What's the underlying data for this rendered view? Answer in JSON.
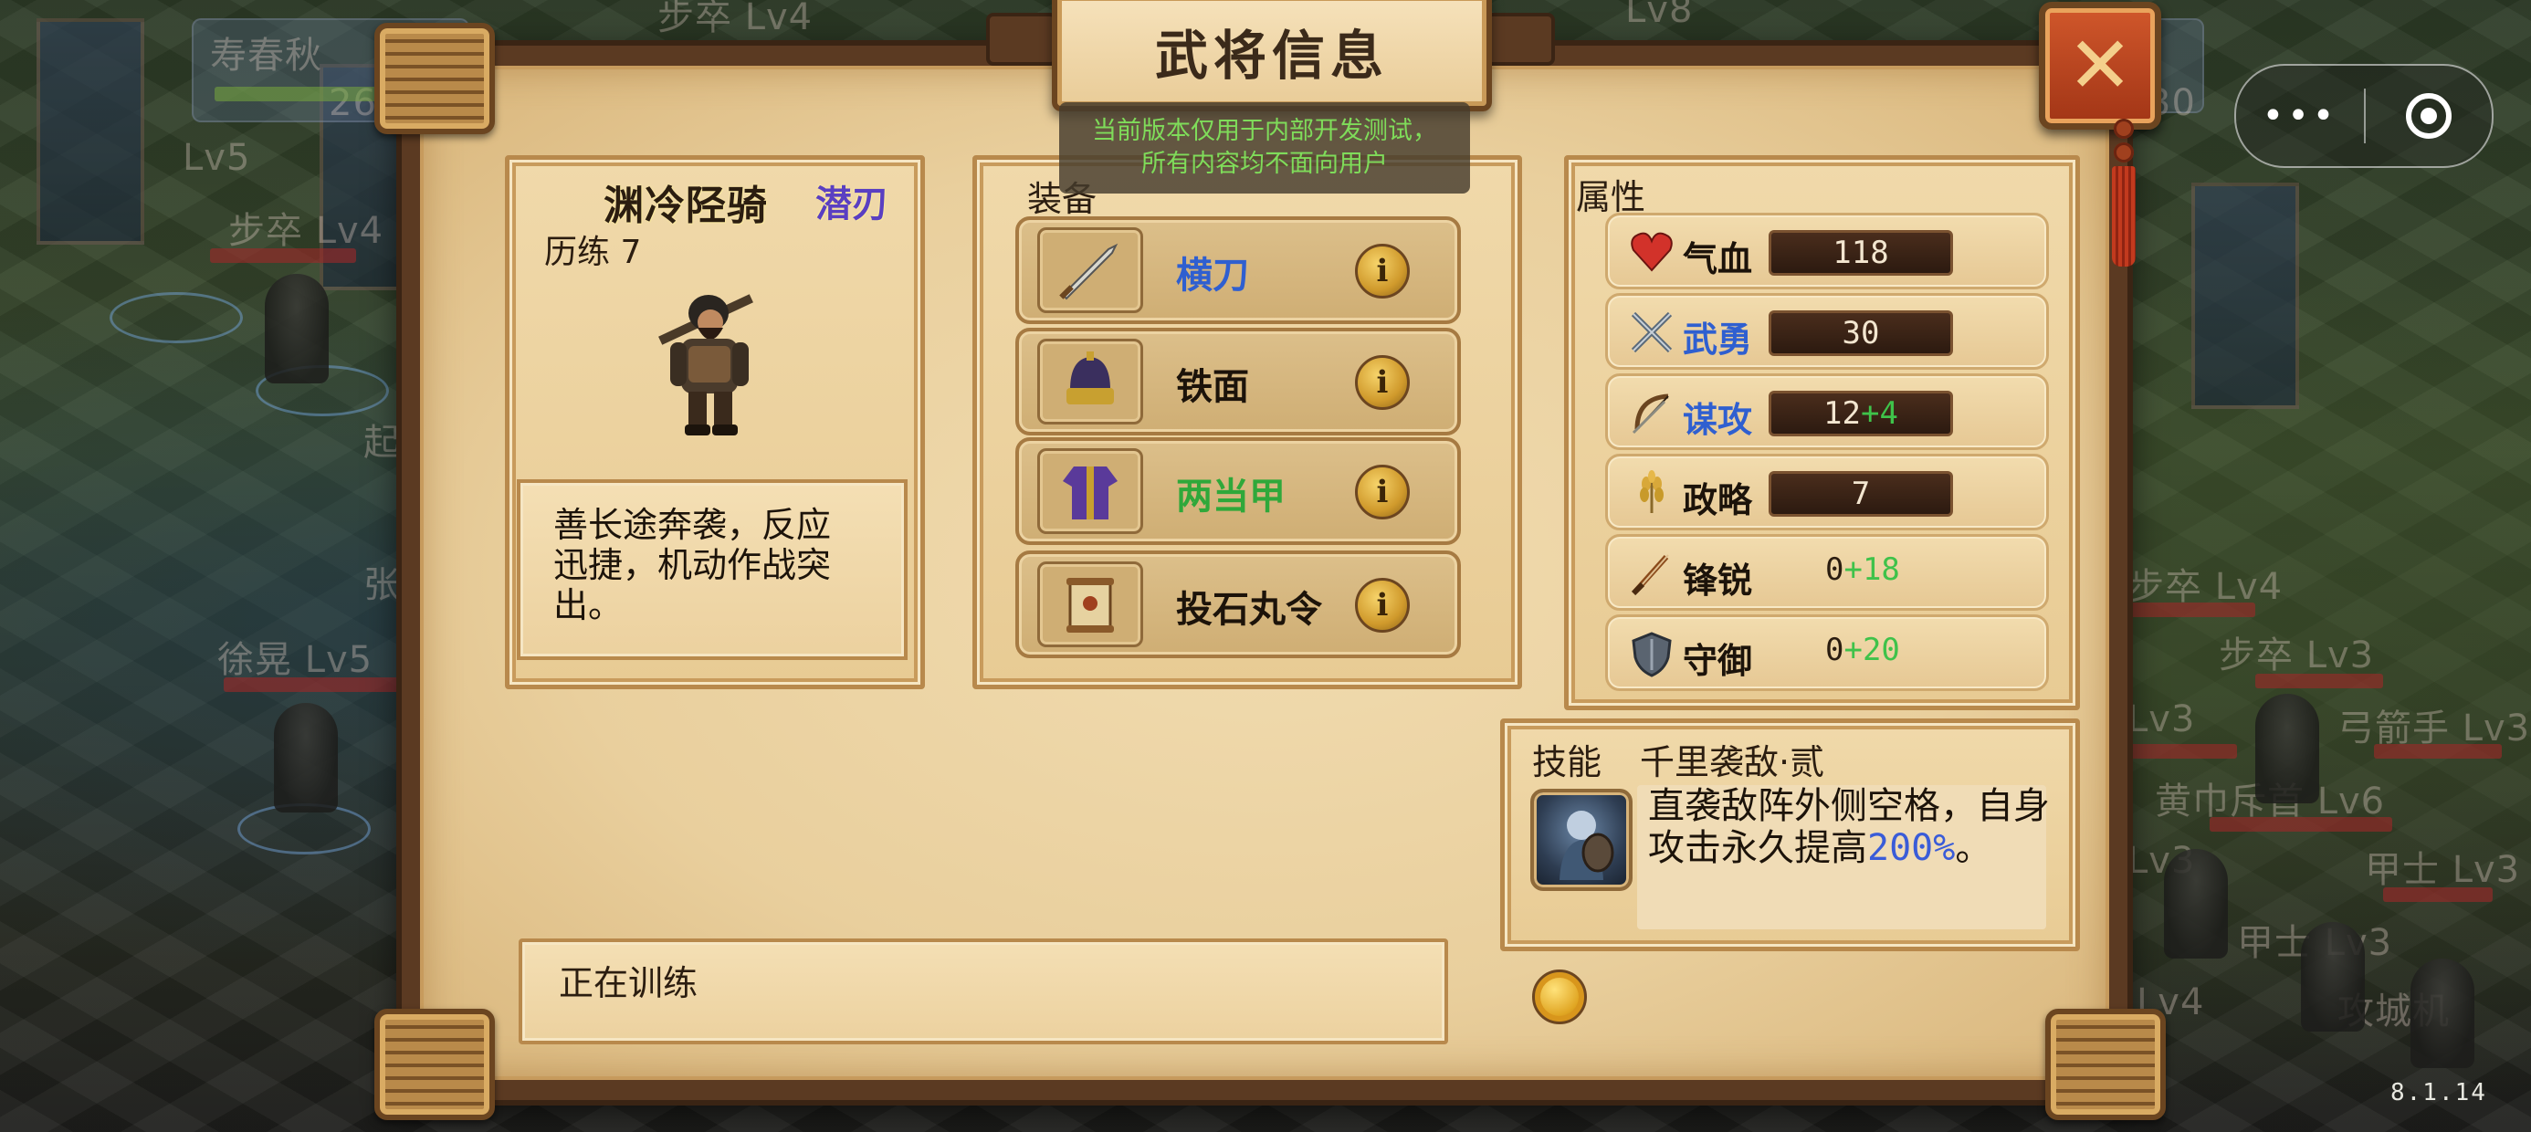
{
  "window": {
    "title": "武将信息",
    "close_label": "✕"
  },
  "capsule": {
    "menu_label": "•••"
  },
  "dev_notice": {
    "line1": "当前版本仅用于内部开发测试，",
    "line2": "所有内容均不面向用户"
  },
  "hero": {
    "name": "渊冷陉骑",
    "class": "潜刃",
    "training": "历练 7",
    "description": "善长途奔袭，反应迅捷，机动作战突出。"
  },
  "equipment": {
    "label": "装备",
    "items": [
      {
        "name": "横刀",
        "color": "#2f5fd0",
        "icon": "sword-icon"
      },
      {
        "name": "铁面",
        "color": "#1c130a",
        "icon": "helmet-icon"
      },
      {
        "name": "两当甲",
        "color": "#2fa83a",
        "icon": "armor-icon"
      },
      {
        "name": "投石丸令",
        "color": "#1c130a",
        "icon": "scroll-icon"
      }
    ],
    "info_label": "i"
  },
  "attributes": {
    "label": "属性",
    "items": [
      {
        "name": "气血",
        "color": "#1c130a",
        "icon": "heart-icon",
        "base": "118",
        "bonus": "",
        "bar": true
      },
      {
        "name": "武勇",
        "color": "#2f5fd0",
        "icon": "crossed-swords-icon",
        "base": "30",
        "bonus": "",
        "bar": true
      },
      {
        "name": "谋攻",
        "color": "#2f5fd0",
        "icon": "bow-icon",
        "base": "12",
        "bonus": "+4",
        "bar": true
      },
      {
        "name": "政略",
        "color": "#1c130a",
        "icon": "wheat-icon",
        "base": "7",
        "bonus": "",
        "bar": true
      },
      {
        "name": "锋锐",
        "color": "#1c130a",
        "icon": "blade-icon",
        "base": "0",
        "bonus": "+18",
        "bar": false
      },
      {
        "name": "守御",
        "color": "#1c130a",
        "icon": "shield-icon",
        "base": "0",
        "bonus": "+20",
        "bar": false
      }
    ]
  },
  "skill": {
    "label": "技能",
    "name": "千里袭敌·贰",
    "text_before": "直袭敌阵外侧空格，自身攻击永久提高",
    "highlight": "200%",
    "text_after": "。"
  },
  "status": {
    "text": "正在训练"
  },
  "version": "8.1.14",
  "background": {
    "labels": [
      "寿春秋",
      "步卒 Lv4",
      "Lv8",
      "步卒 Lv4",
      "Lv5",
      "徐晃 Lv5",
      "起",
      "张",
      "26/",
      "30",
      "步卒 Lv4",
      "步卒 Lv3",
      "Lv3",
      "弓箭手 Lv3",
      "黄巾斥首 Lv6",
      "甲士 Lv3",
      "Lv3",
      "甲士 Lv3",
      "Lv4",
      "攻城机"
    ]
  }
}
